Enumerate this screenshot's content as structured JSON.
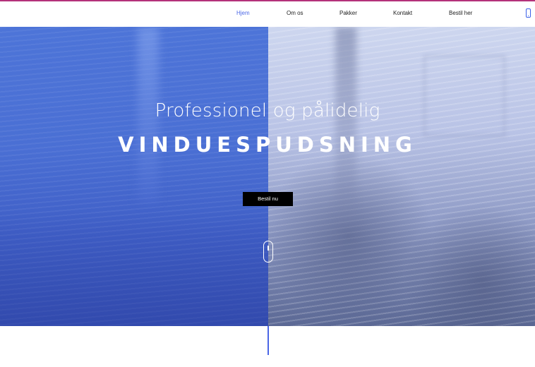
{
  "nav": {
    "items": [
      {
        "label": "Hjem",
        "active": true
      },
      {
        "label": "Om os",
        "active": false
      },
      {
        "label": "Pakker",
        "active": false
      },
      {
        "label": "Kontakt",
        "active": false
      },
      {
        "label": "Bestil her",
        "active": false
      }
    ],
    "icon": "mobile-phone-icon"
  },
  "hero": {
    "subtitle": "Professionel og pålidelig",
    "title": "VINDUESPUDSNING",
    "cta_label": "Bestil nu",
    "scroll_icon": "mouse-scroll-icon"
  },
  "colors": {
    "accent": "#4a66e6",
    "top_border": "#b4327a",
    "hero_left": "#4a6fd4",
    "hero_right": "#b9c3e6",
    "cta_bg": "#000000"
  }
}
